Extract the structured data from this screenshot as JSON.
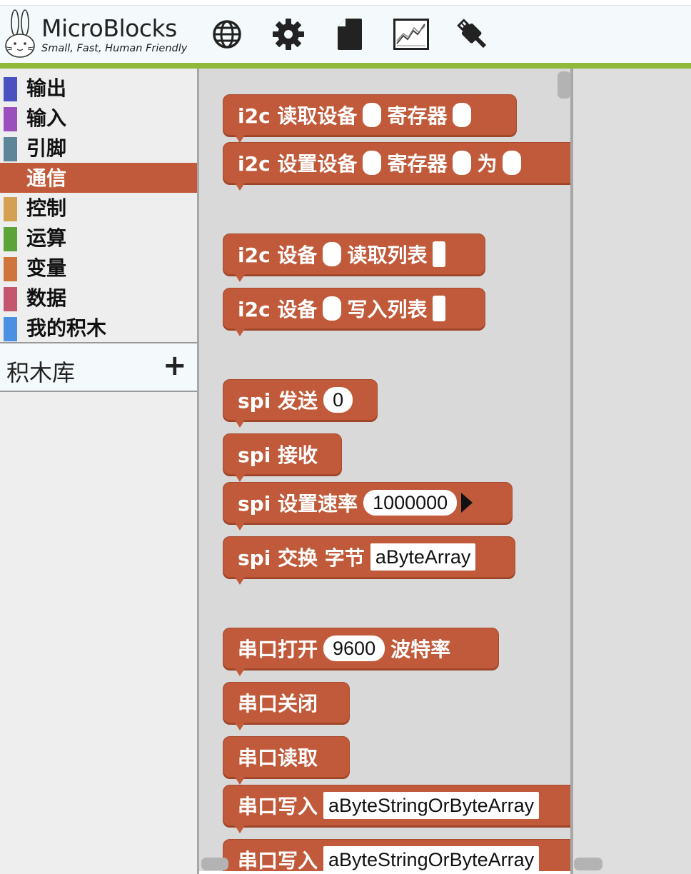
{
  "app": {
    "title": "MicroBlocks",
    "tagline": "Small, Fast, Human Friendly"
  },
  "toolbar": {
    "icons": [
      "globe-icon",
      "gear-icon",
      "file-icon",
      "graph-icon",
      "usb-icon"
    ]
  },
  "categories": [
    {
      "label": "输出",
      "color": "#4a51c0"
    },
    {
      "label": "输入",
      "color": "#9b4fbc"
    },
    {
      "label": "引脚",
      "color": "#5e8699"
    },
    {
      "label": "通信",
      "color": "#c05a3a",
      "selected": true
    },
    {
      "label": "控制",
      "color": "#d4a052"
    },
    {
      "label": "运算",
      "color": "#5ca339"
    },
    {
      "label": "变量",
      "color": "#cf743a"
    },
    {
      "label": "数据",
      "color": "#c4566e"
    },
    {
      "label": "我的积木",
      "color": "#4b90e2"
    }
  ],
  "library": {
    "label": "积木库",
    "add_label": "+"
  },
  "blocks": {
    "i2c_read": {
      "part1": "i2c 读取设备",
      "part2": "寄存器"
    },
    "i2c_set": {
      "part1": "i2c 设置设备",
      "part2": "寄存器",
      "part3": "为"
    },
    "i2c_read_list": {
      "part1": "i2c 设备",
      "part2": "读取列表"
    },
    "i2c_write_list": {
      "part1": "i2c 设备",
      "part2": "写入列表"
    },
    "spi_send": {
      "part1": "spi 发送",
      "value": "0"
    },
    "spi_receive": {
      "part1": "spi 接收"
    },
    "spi_speed": {
      "part1": "spi 设置速率",
      "value": "1000000"
    },
    "spi_exchange": {
      "part1": "spi 交换 字节",
      "value": "aByteArray"
    },
    "serial_open": {
      "part1": "串口打开",
      "value": "9600",
      "part2": "波特率"
    },
    "serial_close": {
      "part1": "串口关闭"
    },
    "serial_read": {
      "part1": "串口读取"
    },
    "serial_write": {
      "part1": "串口写入",
      "value": "aByteStringOrByteArray"
    },
    "serial_write2": {
      "part1": "串口写入",
      "value": "aByteStringOrByteArray"
    }
  },
  "colors": {
    "accent": "#90b83b",
    "comm_block": "#c05a3a",
    "palette_bg": "#d9d9d9"
  }
}
